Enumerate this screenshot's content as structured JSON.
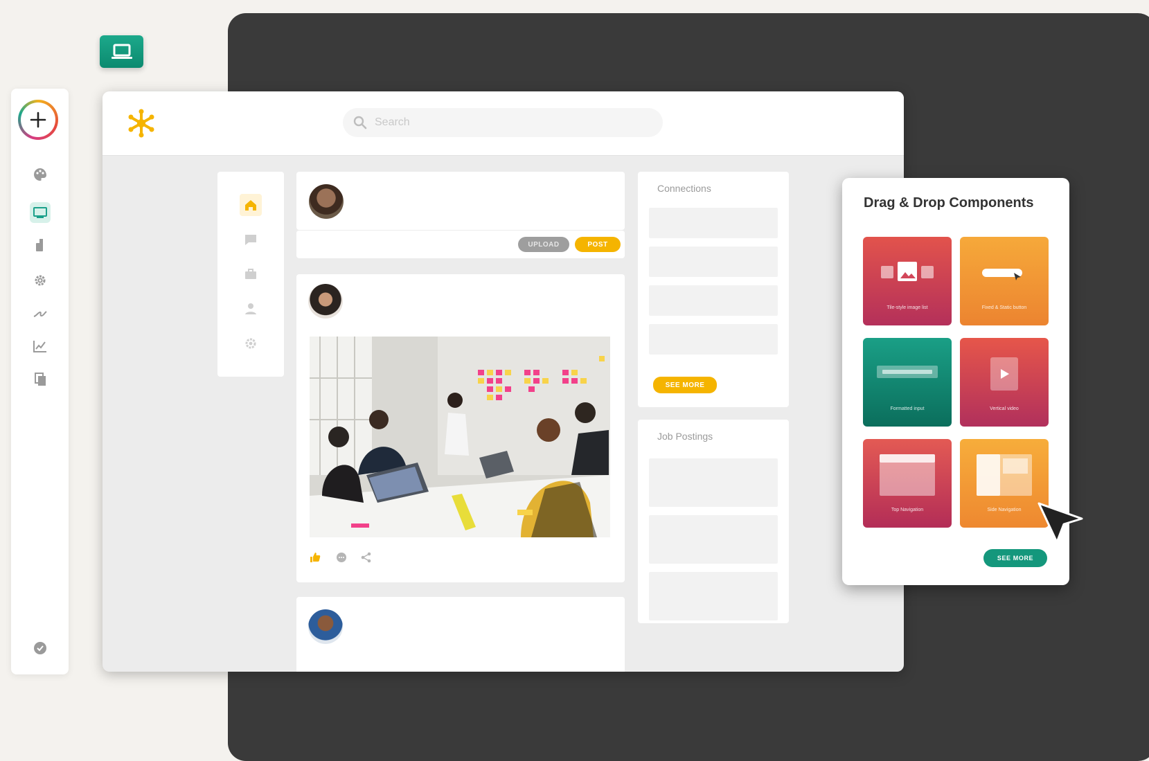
{
  "search": {
    "placeholder": "Search"
  },
  "composer": {
    "secondary_label": "UPLOAD",
    "post_label": "POST"
  },
  "connections": {
    "title": "Connections",
    "see_more_label": "SEE MORE"
  },
  "jobs": {
    "title": "Job Postings"
  },
  "dragdrop": {
    "title": "Drag & Drop Components",
    "tiles": [
      {
        "label": "Tile-style image list"
      },
      {
        "label": "Fixed & Static button"
      },
      {
        "label": "Formatted input"
      },
      {
        "label": "Vertical video"
      },
      {
        "label": "Top Navigation"
      },
      {
        "label": "Side Navigation"
      }
    ],
    "see_more_label": "SEE MORE"
  },
  "colors": {
    "accent_yellow": "#f5b400",
    "teal": "#14977c",
    "dark_panel": "#3a3a3a"
  },
  "icons": {
    "rail": [
      "palette-icon",
      "screen-icon",
      "paint-bucket-icon",
      "gear-icon",
      "signature-icon",
      "chart-icon",
      "pages-icon",
      "help-icon"
    ],
    "nav": [
      "home-icon",
      "chat-icon",
      "briefcase-icon",
      "person-icon",
      "settings-icon"
    ],
    "post_actions": [
      "thumbs-up-icon",
      "comment-icon",
      "share-icon"
    ]
  }
}
